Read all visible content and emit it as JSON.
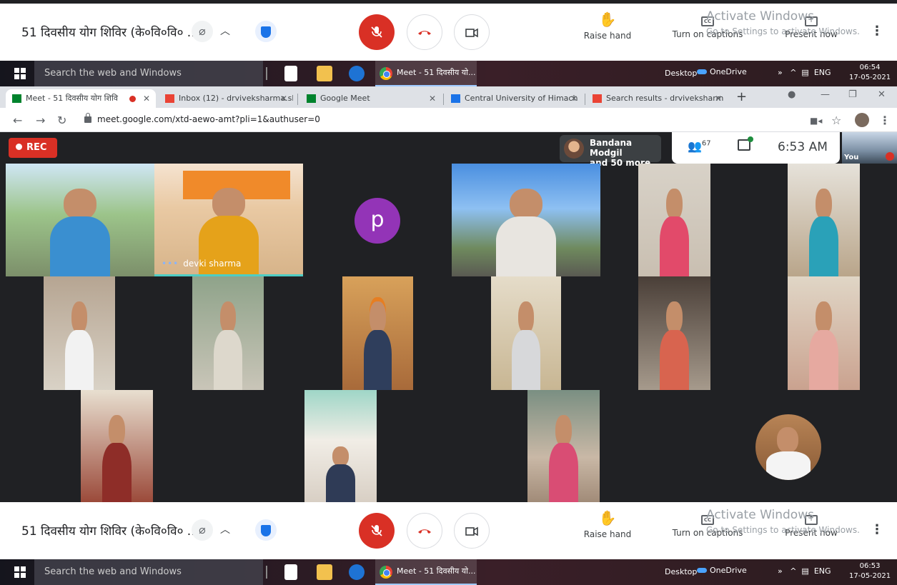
{
  "meeting": {
    "title": "51 दिवसीय योग शिविर (के०वि०वि० ...",
    "raise_hand": "Raise hand",
    "captions": "Turn on captions",
    "present": "Present now",
    "watermark_line1": "Activate Windows",
    "watermark_line2": "Go to Settings to activate Windows."
  },
  "taskbar_top": {
    "search_placeholder": "Search the web and Windows",
    "meet_window": "Meet - 51 दिवसीय यो...",
    "desktop": "Desktop",
    "onedrive": "OneDrive",
    "lang": "ENG",
    "time": "06:54",
    "date": "17-05-2021"
  },
  "taskbar_bottom": {
    "search_placeholder": "Search the web and Windows",
    "meet_window": "Meet - 51 दिवसीय यो...",
    "desktop": "Desktop",
    "onedrive": "OneDrive",
    "lang": "ENG",
    "time": "06:53",
    "date": "17-05-2021"
  },
  "browser": {
    "tabs": [
      {
        "label": "Meet - 51 दिवसीय योग शिवि"
      },
      {
        "label": "Inbox (12) - drviveksharma.sk"
      },
      {
        "label": "Google Meet"
      },
      {
        "label": "Central University of Himach"
      },
      {
        "label": "Search results - drviveksharm"
      }
    ],
    "url": "meet.google.com/xtd-aewo-amt?pli=1&authuser=0"
  },
  "call": {
    "rec_label": "REC",
    "presenter_name": "Bandana Modgil",
    "presenter_more": "and 50 more",
    "participant_count": "67",
    "clock": "6:53 AM",
    "self_label": "You",
    "tile_name": "devki sharma",
    "avatar_letter": "p"
  },
  "colors": {
    "end_call_red": "#d93025",
    "avatar_purple": "#9334b7",
    "meet_dark": "#202124"
  }
}
